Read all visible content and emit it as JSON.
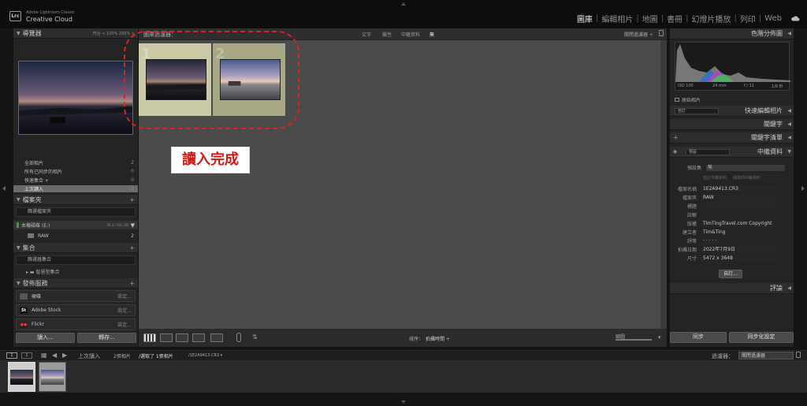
{
  "app": {
    "logo_text": "Lrc",
    "brand_line1": "Adobe Lightroom Classic",
    "brand_line2": "Creative Cloud"
  },
  "modules": [
    "圖庫",
    "編輯相片",
    "地圖",
    "書冊",
    "幻燈片播放",
    "列印",
    "Web"
  ],
  "active_module": "圖庫",
  "navigator": {
    "title": "導覽器",
    "options": "符合 ÷  100%  200% ÷"
  },
  "catalog": {
    "rows": [
      {
        "label": "全部相片",
        "count": "2"
      },
      {
        "label": "所有已同步的相片",
        "count": "0"
      },
      {
        "label": "快速集合 +",
        "count": "0"
      },
      {
        "label": "上次讀入",
        "count": "2",
        "selected": true
      }
    ]
  },
  "folders": {
    "title": "檔案夾",
    "search_placeholder": "篩選檔案夾",
    "volume": "本機磁碟 (E:)",
    "volume_size": "56.3 / 931 GB",
    "subfolder": "RAW",
    "subfolder_count": "2"
  },
  "collections": {
    "title": "集合",
    "search_placeholder": "篩選器集合",
    "smart": "智慧型集合"
  },
  "publish": {
    "title": "發佈服務",
    "services": [
      {
        "name": "硬碟",
        "action": "設定...",
        "icon": "hard-drive-icon"
      },
      {
        "name": "Adobe Stock",
        "action": "設定...",
        "icon": "adobe-stock-icon"
      },
      {
        "name": "Flickr",
        "action": "設定...",
        "icon": "flickr-icon"
      }
    ]
  },
  "left_buttons": {
    "import": "讀入...",
    "export": "轉存..."
  },
  "filter_bar": {
    "title": "圖庫過濾器：",
    "tabs": [
      "文字",
      "屬性",
      "中繼資料",
      "無"
    ],
    "preset": "關閉過濾器 ÷"
  },
  "callout": {
    "text": "讀入完成"
  },
  "toolbar": {
    "sort_label": "排序：",
    "sort_value": "拍攝時間 ÷",
    "thumb_label": "縮圖"
  },
  "histogram": {
    "title": "色階分佈圖",
    "iso": "ISO 100",
    "focal": "24 mm",
    "aperture": "f / 11",
    "shutter": "1/8 秒",
    "original_label": "原始相片"
  },
  "right_panel": {
    "quick_develop": "快速編輯相片",
    "quick_develop_preset": "自訂",
    "keywording": "關鍵字",
    "keyword_list": "關鍵字清單",
    "metadata": "中繼資料",
    "metadata_preset": "預設",
    "preset_label": "預設集",
    "preset_value": "無",
    "tabs": [
      "自訂中繼資料",
      "儲存的中繼資料"
    ],
    "fields": [
      {
        "k": "檔案名稱",
        "v": "1E2A9413.CR3"
      },
      {
        "k": "檔案夾",
        "v": "RAW"
      },
      {
        "k": "標題",
        "v": ""
      },
      {
        "k": "註解",
        "v": ""
      },
      {
        "k": "版權",
        "v": "TimTingTravel.com Copyright"
      },
      {
        "k": "建立者",
        "v": "Tim&Ting"
      },
      {
        "k": "評等",
        "v": "·  ·  ·  ·  ·"
      },
      {
        "k": "拍攝日期",
        "v": "2022年7月9日"
      },
      {
        "k": "尺寸",
        "v": "5472 x 3648"
      }
    ],
    "customize_button": "自訂...",
    "comments": "評論",
    "sync_button": "同步",
    "sync_settings_button": "同步化設定"
  },
  "filmstrip_bar": {
    "page1": "1",
    "page2": "2",
    "source": "上次讀入",
    "count_text": "2張相片",
    "selected_text": "/選取了 1張相片",
    "filename": "/1E2A9413.CR3 ▾",
    "filter_label": "過濾器：",
    "filter_value": "關閉過濾器"
  },
  "colors": {
    "callout_red": "#d41a1a",
    "selected_cell": "#cbcaa8",
    "bg_dark": "#141414"
  }
}
